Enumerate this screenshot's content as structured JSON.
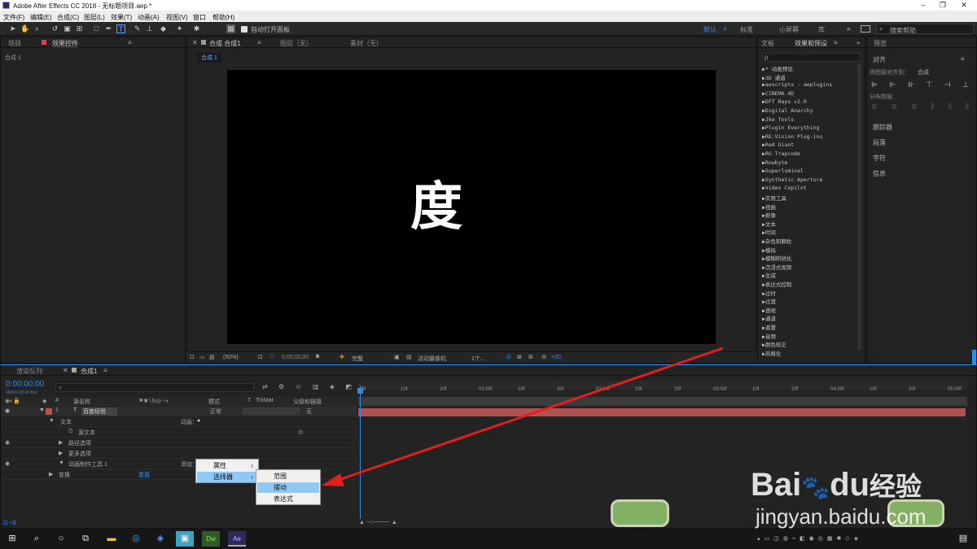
{
  "window": {
    "title": "Adobe After Effects CC 2018 - 无标题项目.aep *"
  },
  "menu": [
    "文件(F)",
    "编辑(E)",
    "合成(C)",
    "图层(L)",
    "效果(T)",
    "动画(A)",
    "视图(V)",
    "窗口",
    "帮助(H)"
  ],
  "toolbar": {
    "auto_open": "自动打开面板",
    "workspaces": [
      "默认",
      "标准",
      "小屏幕",
      "库"
    ],
    "search_placeholder": "搜索帮助"
  },
  "project": {
    "tab": "项目",
    "effects_tab": "效果控件",
    "comp_label": "合成 1"
  },
  "comp_panel": {
    "tab": "合成 合成1",
    "layer": "图层（无）",
    "footage": "素材（无）",
    "subtab": "合成 1",
    "viewer_text": "度"
  },
  "viewer_bar": {
    "zoom": "(50%)",
    "time": "0;00;00;00",
    "quality": "完整",
    "camera": "活动摄像机",
    "views": "1个...",
    "offset": "+00"
  },
  "effects_panel": {
    "tab_text": "文板",
    "tab": "效果和预设",
    "search_placeholder": "ρ",
    "items": [
      "* 动画预设",
      "3D 通道",
      "aescripts - aeplugins",
      "CINEMA 4D",
      "DFT Rays v2.0",
      "Digital Anarchy",
      "Jke Tools",
      "Plugin Everything",
      "RE:Vision Plug-ins",
      "Red Giant",
      "RG Trapcode",
      "Rowbyte",
      "Superluminal",
      "Synthetic Aperture",
      "Video Copilot",
      "实用工具",
      "扭曲",
      "抠像",
      "文本",
      "时间",
      "杂色和颗粒",
      "模拟",
      "模糊和锐化",
      "沉浸式视频",
      "生成",
      "表达式控制",
      "过时",
      "过渡",
      "透视",
      "通道",
      "遮罩",
      "音频",
      "颜色校正",
      "风格化"
    ]
  },
  "right_panel": {
    "preview": "预览",
    "align": "对齐",
    "align_to_label": "将图层对齐到：",
    "align_to": "合成",
    "distribute": "分布图层：",
    "tracker": "跟踪器",
    "paragraph": "段落",
    "character": "字符",
    "info": "信息"
  },
  "timeline": {
    "render_tab": "渲染队列",
    "comp_tab": "合成1",
    "timecode": "0:00:00:00",
    "fps": "00000 (30.00 fps)",
    "cols": {
      "num": "#",
      "name": "源名称",
      "mode": "模式",
      "t": "T",
      "trkmat": "TrkMat",
      "parent": "父级和链接"
    },
    "layer": {
      "num": "1",
      "name": "百度经验",
      "mode": "正常",
      "parent": "无"
    },
    "rows": [
      "文本",
      "源文本",
      "路径选项",
      "更多选项",
      "动画制作工具 1",
      "变换"
    ],
    "animate": "动画：",
    "add": "添加：",
    "reset": "重置",
    "ruler": [
      "0f",
      "10f",
      "20f",
      "01:00f",
      "10f",
      "20f",
      "02:00f",
      "10f",
      "20f",
      "03:00f",
      "10f",
      "20f",
      "04:00f",
      "10f",
      "20f",
      "05:00f"
    ]
  },
  "context_menu": {
    "l1": [
      "属性",
      "选择器"
    ],
    "l2": [
      "范围",
      "摆动",
      "表达式"
    ]
  },
  "watermark": {
    "brand": "Bai",
    "du": "du",
    "jy": "经验",
    "url": "jingyan.baidu.com"
  },
  "colors": {
    "accent": "#2d8ceb",
    "arrow": "#e02020",
    "layer_bar": "#b05050"
  }
}
